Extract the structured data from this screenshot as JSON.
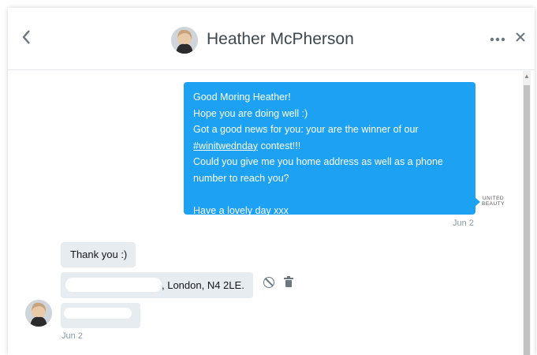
{
  "header": {
    "back_icon": "chevron-left-icon",
    "title": "Heather McPherson",
    "more_icon": "more-icon",
    "close_icon": "close-icon"
  },
  "outgoing": {
    "lines": [
      "Good Moring Heather!",
      "Hope you are doing well :)",
      "Got a good news for you: your are the winner of our",
      "contest!!!",
      "Could you give me you home address as well as a phone",
      "number to reach you?",
      "Have a lovely day xxx"
    ],
    "hashtag": "#winitwednday",
    "brand_line1": "UNITED",
    "brand_line2": "BEAUTY",
    "timestamp": "Jun 2"
  },
  "incoming": {
    "message1": "Thank you :)",
    "message2_visible": ", London, N4 2LE.",
    "timestamp": "Jun 2"
  },
  "colors": {
    "outgoing_bubble": "#1da1f2",
    "incoming_bubble": "#e6ecf0"
  }
}
